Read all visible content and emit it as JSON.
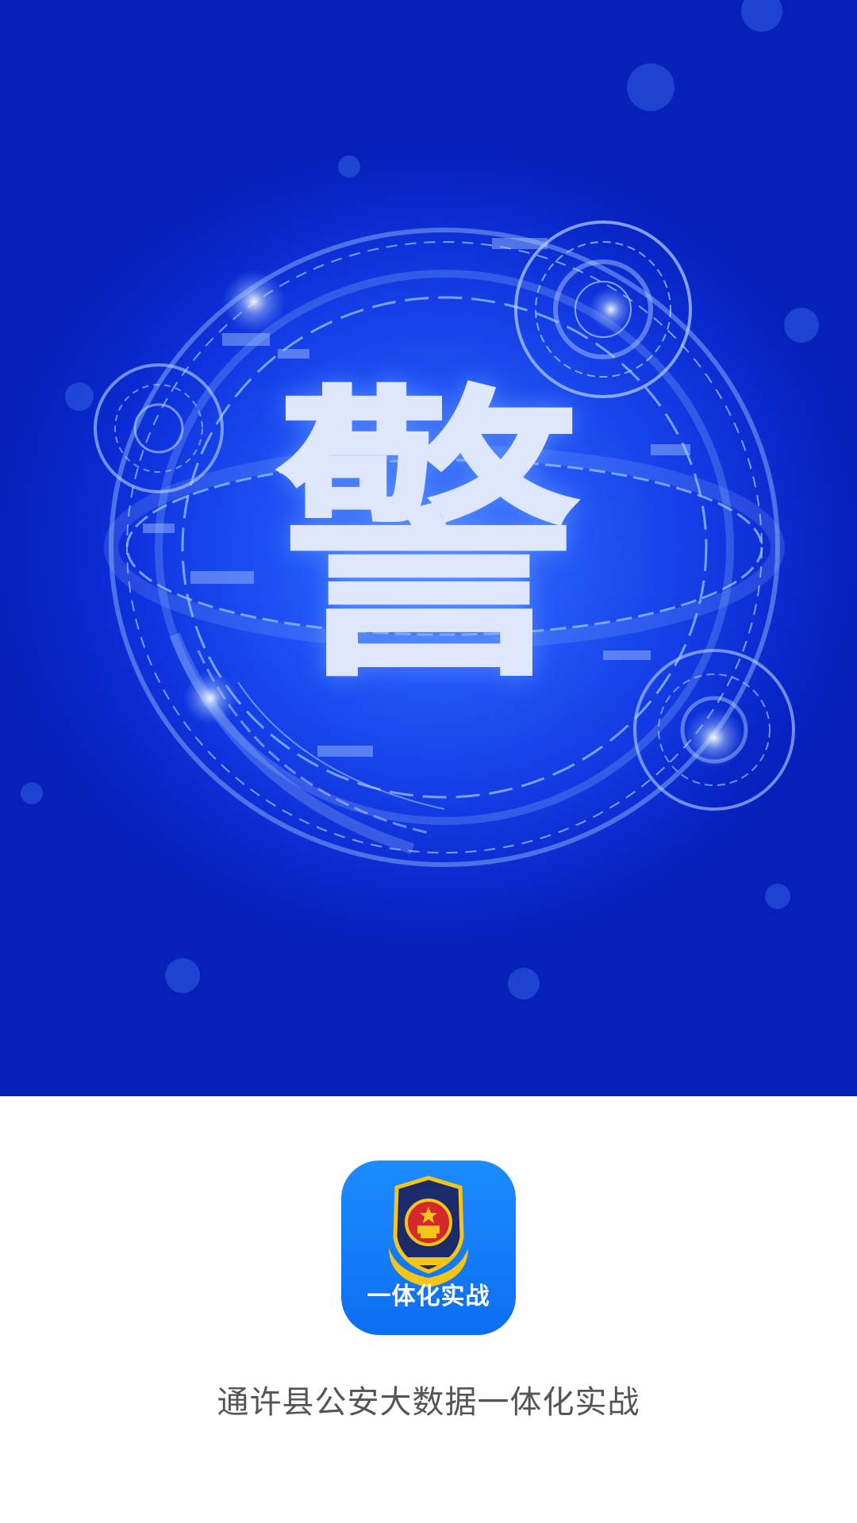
{
  "splash": {
    "hero_character": "警",
    "app_icon": {
      "label": "一体化实战",
      "emblem": "police-emblem-icon",
      "background_color": "#1a80ff"
    },
    "app_name": "通许县公安大数据一体化实战"
  },
  "colors": {
    "hero_blue": "#0f3ff0",
    "character": "#dfe7ff",
    "caption": "#555555"
  }
}
